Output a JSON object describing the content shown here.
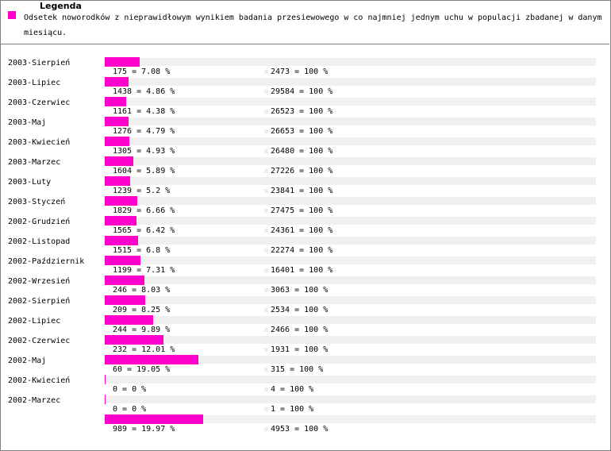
{
  "legend": {
    "title": "Legenda",
    "text": "Odsetek noworodków z nieprawidłowym wynikiem badania przesiewowego w co najmniej jednym uchu w populacji zbadanej w danym miesiącu."
  },
  "colors": {
    "bar": "#ff00cc",
    "track": "#f0f0f0"
  },
  "chart_data": {
    "type": "bar",
    "orientation": "horizontal",
    "xlim": [
      0,
      100
    ],
    "categories": [
      "2003-Sierpień",
      "2003-Lipiec",
      "2003-Czerwiec",
      "2003-Maj",
      "2003-Kwiecień",
      "2003-Marzec",
      "2003-Luty",
      "2003-Styczeń",
      "2002-Grudzień",
      "2002-Listopad",
      "2002-Październik",
      "2002-Wrzesień",
      "2002-Sierpień",
      "2002-Lipiec",
      "2002-Czerwiec",
      "2002-Maj",
      "2002-Kwiecień",
      "2002-Marzec",
      ""
    ],
    "values": [
      7.08,
      4.86,
      4.38,
      4.79,
      4.93,
      5.89,
      5.2,
      6.66,
      6.42,
      6.8,
      7.31,
      8.03,
      8.25,
      9.89,
      12.01,
      19.05,
      0,
      0,
      19.97
    ],
    "value_labels": [
      "175 = 7.08 %",
      "1438 = 4.86 %",
      "1161 = 4.38 %",
      "1276 = 4.79 %",
      "1305 = 4.93 %",
      "1604 = 5.89 %",
      "1239 = 5.2 %",
      "1829 = 6.66 %",
      "1565 = 6.42 %",
      "1515 = 6.8 %",
      "1199 = 7.31 %",
      "246 = 8.03 %",
      "209 = 8.25 %",
      "244 = 9.89 %",
      "232 = 12.01 %",
      "60 = 19.05 %",
      "0 = 0 %",
      "0 = 0 %",
      "989 = 19.97 %"
    ],
    "total_labels": [
      "2473 = 100 %",
      "29584 = 100 %",
      "26523 = 100 %",
      "26653 = 100 %",
      "26480 = 100 %",
      "27226 = 100 %",
      "23841 = 100 %",
      "27475 = 100 %",
      "24361 = 100 %",
      "22274 = 100 %",
      "16401 = 100 %",
      "3063 = 100 %",
      "2534 = 100 %",
      "2466 = 100 %",
      "1931 = 100 %",
      "315 = 100 %",
      "4 = 100 %",
      "1 = 100 %",
      "4953 = 100 %"
    ]
  }
}
